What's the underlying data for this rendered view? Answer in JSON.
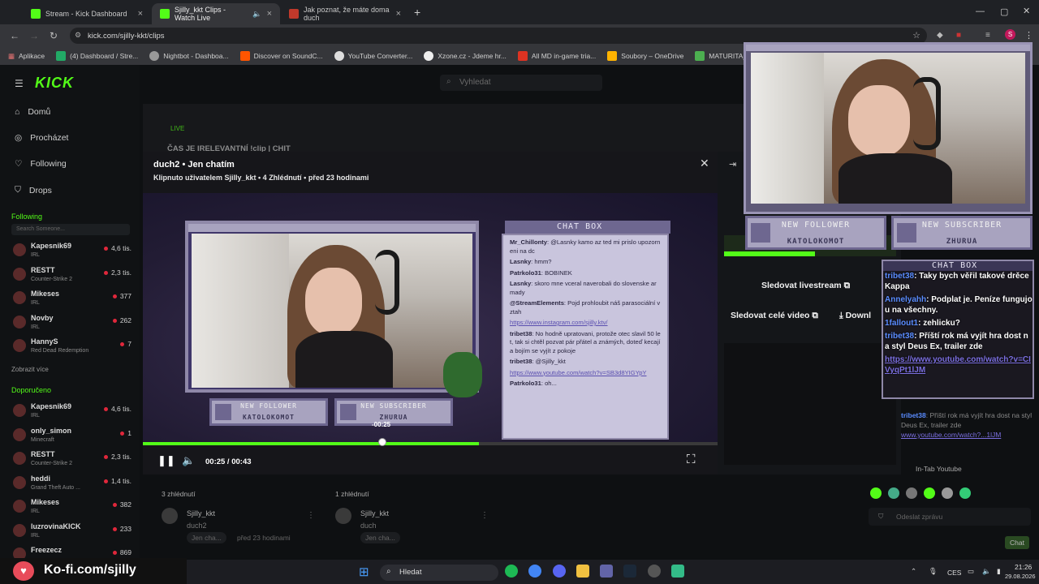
{
  "browser": {
    "tabs": [
      {
        "title": "Stream - Kick Dashboard",
        "fav_color": "#53fc18"
      },
      {
        "title": "Sjilly_kkt Clips - Watch Live",
        "fav_color": "#53fc18"
      },
      {
        "title": "Jak poznat, že máte doma duch",
        "fav_color": "#c0392b"
      }
    ],
    "url": "kick.com/sjilly-kkt/clips",
    "bookmarks": [
      "Aplikace",
      "(4) Dashboard / Stre...",
      "Nightbot - Dashboa...",
      "Discover on SoundC...",
      "YouTube Converter...",
      "Xzone.cz - Jdeme hr...",
      "All MD in-game tria...",
      "Soubory – OneDrive",
      "MATURITA_OKRUH..."
    ]
  },
  "kick": {
    "logo": "KICK",
    "search_placeholder": "Vyhledat",
    "nav": [
      "Domů",
      "Procházet",
      "Following",
      "Drops"
    ],
    "following_title": "Following",
    "sidebar_search": "Search Someone...",
    "following": [
      {
        "name": "Kapesnik69",
        "cat": "IRL",
        "count": "4,6 tis."
      },
      {
        "name": "RESTT",
        "cat": "Counter-Strike 2",
        "count": "2,3 tis."
      },
      {
        "name": "Mikeses",
        "cat": "IRL",
        "count": "377"
      },
      {
        "name": "Novby",
        "cat": "IRL",
        "count": "262"
      },
      {
        "name": "HannyS",
        "cat": "Red Dead Redemption",
        "count": "7"
      }
    ],
    "show_more": "Zobrazit více",
    "recommended_title": "Doporučeno",
    "recommended": [
      {
        "name": "Kapesnik69",
        "cat": "IRL",
        "count": "4,6 tis."
      },
      {
        "name": "only_simon",
        "cat": "Minecraft",
        "count": "1"
      },
      {
        "name": "RESTT",
        "cat": "Counter-Strike 2",
        "count": "2,3 tis."
      },
      {
        "name": "heddi",
        "cat": "Grand Theft Auto ...",
        "count": "1,4 tis."
      },
      {
        "name": "Mikeses",
        "cat": "IRL",
        "count": "382"
      },
      {
        "name": "luzrovinaKICK",
        "cat": "IRL",
        "count": "233"
      },
      {
        "name": "Freezecz",
        "cat": "",
        "count": "869"
      }
    ],
    "live_badge": "LIVE",
    "bg_title": "ČAS JE IRELEVANTNÍ !clip | CHIT"
  },
  "clip": {
    "title": "duch2 • Jen chatím",
    "subtitle": "Klipnuto uživatelem Sjilly_kkt • 4 Zhlédnutí • před 23 hodinami",
    "time": "00:25 / 00:43",
    "scrub_tooltip": "-00:25",
    "progress": 0.585,
    "watched": 0.41
  },
  "overlay": {
    "new_follower_label": "NEW FOLLOWER",
    "new_follower_name": "KATOLOKOMOT",
    "new_sub_label": "NEW SUBSCRIBER",
    "new_sub_name": "ZHURUA",
    "chatbox_title": "CHAT BOX",
    "video_chat": [
      {
        "user": "Mr_Chillonty",
        "text": ": @Lasnky kamo az ted mi prislo upozorneni na dc"
      },
      {
        "user": "Lasnky",
        "text": ": hmm?"
      },
      {
        "user": "Patrkolo31",
        "text": ": BOBINEK"
      },
      {
        "user": "Lasnky",
        "text": ": skoro mne vceral naverobali do slovenske armady"
      },
      {
        "user": "@StreamElements",
        "text": ": Pojd prohloubit náš parasociální vztah"
      },
      {
        "user": "",
        "text": "https://www.instagram.com/sjilly.ktv/"
      },
      {
        "user": "tribet38",
        "text": ": No hodně upratovani, protože otec slavil 50 let, tak si chtěl pozvat pár přátel a známých, doteď kecají a bojím se vyjít z pokoje"
      },
      {
        "user": "tribet38",
        "text": ": @Sjilly_kkt"
      },
      {
        "user": "",
        "text": "https://www.youtube.com/watch?v=SB3d8YIGYpY"
      },
      {
        "user": "Patrkolo31",
        "text": ": oh..."
      }
    ],
    "live_chat": [
      {
        "user": "tribet38",
        "text": ": Taky bych věřil takové drěce Kappa"
      },
      {
        "user": "Annelyahh",
        "text": ": Podplat je. Peníze fungujou na všechny."
      },
      {
        "user": "1fallout1",
        "text": ": zehlicku?"
      },
      {
        "user": "tribet38",
        "text": ": Příští rok má vyjít hra dost na styl Deus Ex, trailer zde"
      },
      {
        "user": "",
        "text": "https://www.youtube.com/watch?v=CIVyqPt1lJM"
      }
    ]
  },
  "right_panel": {
    "follow_live": "Sledovat livestream",
    "follow_full": "Sledovat celé video",
    "download": "Downl",
    "chat_tail": ": Příští rok má vyjít hra dost na styl Deus Ex, trailer zde",
    "chat_tail_user": "tribet38",
    "chat_tail_link": "www.youtube.com/watch?...1lJM",
    "in_tab": "In-Tab Youtube",
    "send_placeholder": "Odeslat zprávu",
    "chat_button": "Chat"
  },
  "clips_grid": [
    {
      "views": "3 zhlédnutí",
      "author": "Sjilly_kkt",
      "title": "duch2",
      "tag": "Jen cha...",
      "age": "před 23 hodinami"
    },
    {
      "views": "1 zhlédnutí",
      "author": "Sjilly_kkt",
      "title": "duch",
      "tag": "Jen cha...",
      "age": "před 23 hodinami"
    }
  ],
  "taskbar": {
    "kofi": "Ko-fi.com/sjilly",
    "search": "Hledat",
    "lang": "CES",
    "time": "21:26",
    "date": "29.08.2026"
  },
  "colors": {
    "kick_green": "#53fc18",
    "overlay_purple": "#a8a3bf"
  }
}
